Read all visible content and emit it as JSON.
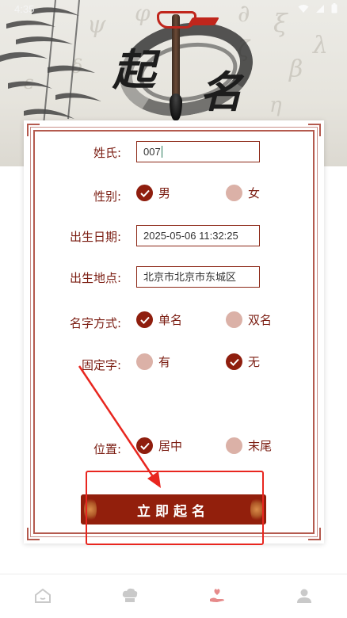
{
  "status_bar": {
    "time": "4:35"
  },
  "banner": {
    "title_char_1": "起",
    "title_char_2": "名"
  },
  "form": {
    "surname": {
      "label": "姓氏:",
      "value": "007"
    },
    "gender": {
      "label": "性别:",
      "options": [
        {
          "text": "男",
          "selected": true
        },
        {
          "text": "女",
          "selected": false
        }
      ]
    },
    "birth_date": {
      "label": "出生日期:",
      "value": "2025-05-06 11:32:25"
    },
    "birth_place": {
      "label": "出生地点:",
      "value": "北京市北京市东城区"
    },
    "name_style": {
      "label": "名字方式:",
      "options": [
        {
          "text": "单名",
          "selected": true
        },
        {
          "text": "双名",
          "selected": false
        }
      ]
    },
    "fixed_char": {
      "label": "固定字:",
      "options": [
        {
          "text": "有",
          "selected": false
        },
        {
          "text": "无",
          "selected": true
        }
      ]
    },
    "position": {
      "label": "位置:",
      "options": [
        {
          "text": "居中",
          "selected": true
        },
        {
          "text": "末尾",
          "selected": false
        }
      ]
    },
    "submit_label": "立即起名"
  },
  "colors": {
    "accent": "#921f0c",
    "label": "#7b1d12",
    "radio_off": "#dbb1a7",
    "annotation": "#e8261f"
  },
  "bottom_nav": {
    "active_index": 2,
    "items": [
      {
        "icon": "home-icon"
      },
      {
        "icon": "chef-hat-icon"
      },
      {
        "icon": "heart-hand-icon"
      },
      {
        "icon": "user-icon"
      }
    ]
  }
}
